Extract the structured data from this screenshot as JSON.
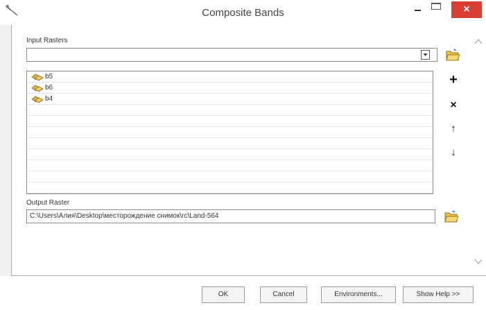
{
  "window": {
    "title": "Composite Bands",
    "close_glyph": "×"
  },
  "form": {
    "input_rasters_label": "Input Rasters",
    "input_rasters_value": "",
    "input_rasters_items": [
      "b5",
      "b6",
      "b4"
    ],
    "output_raster_label": "Output Raster",
    "output_raster_value": "C:\\Users\\Алия\\Desktop\\месторождение снимок\\rc\\Land-564"
  },
  "side_buttons": {
    "add": "+",
    "remove": "×",
    "up": "↑",
    "down": "↓"
  },
  "buttons": {
    "ok": "OK",
    "cancel": "Cancel",
    "environments": "Environments...",
    "show_help": "Show Help >>"
  },
  "icons": [
    "hammer-icon",
    "folder-open-icon",
    "raster-layer-icon",
    "add-icon",
    "remove-icon",
    "move-up-icon",
    "move-down-icon",
    "minimize-icon",
    "maximize-icon",
    "close-icon"
  ],
  "colors": {
    "close_button": "#d94033",
    "folder_yellow": "#e8c04a",
    "border": "#8a8a8a"
  }
}
